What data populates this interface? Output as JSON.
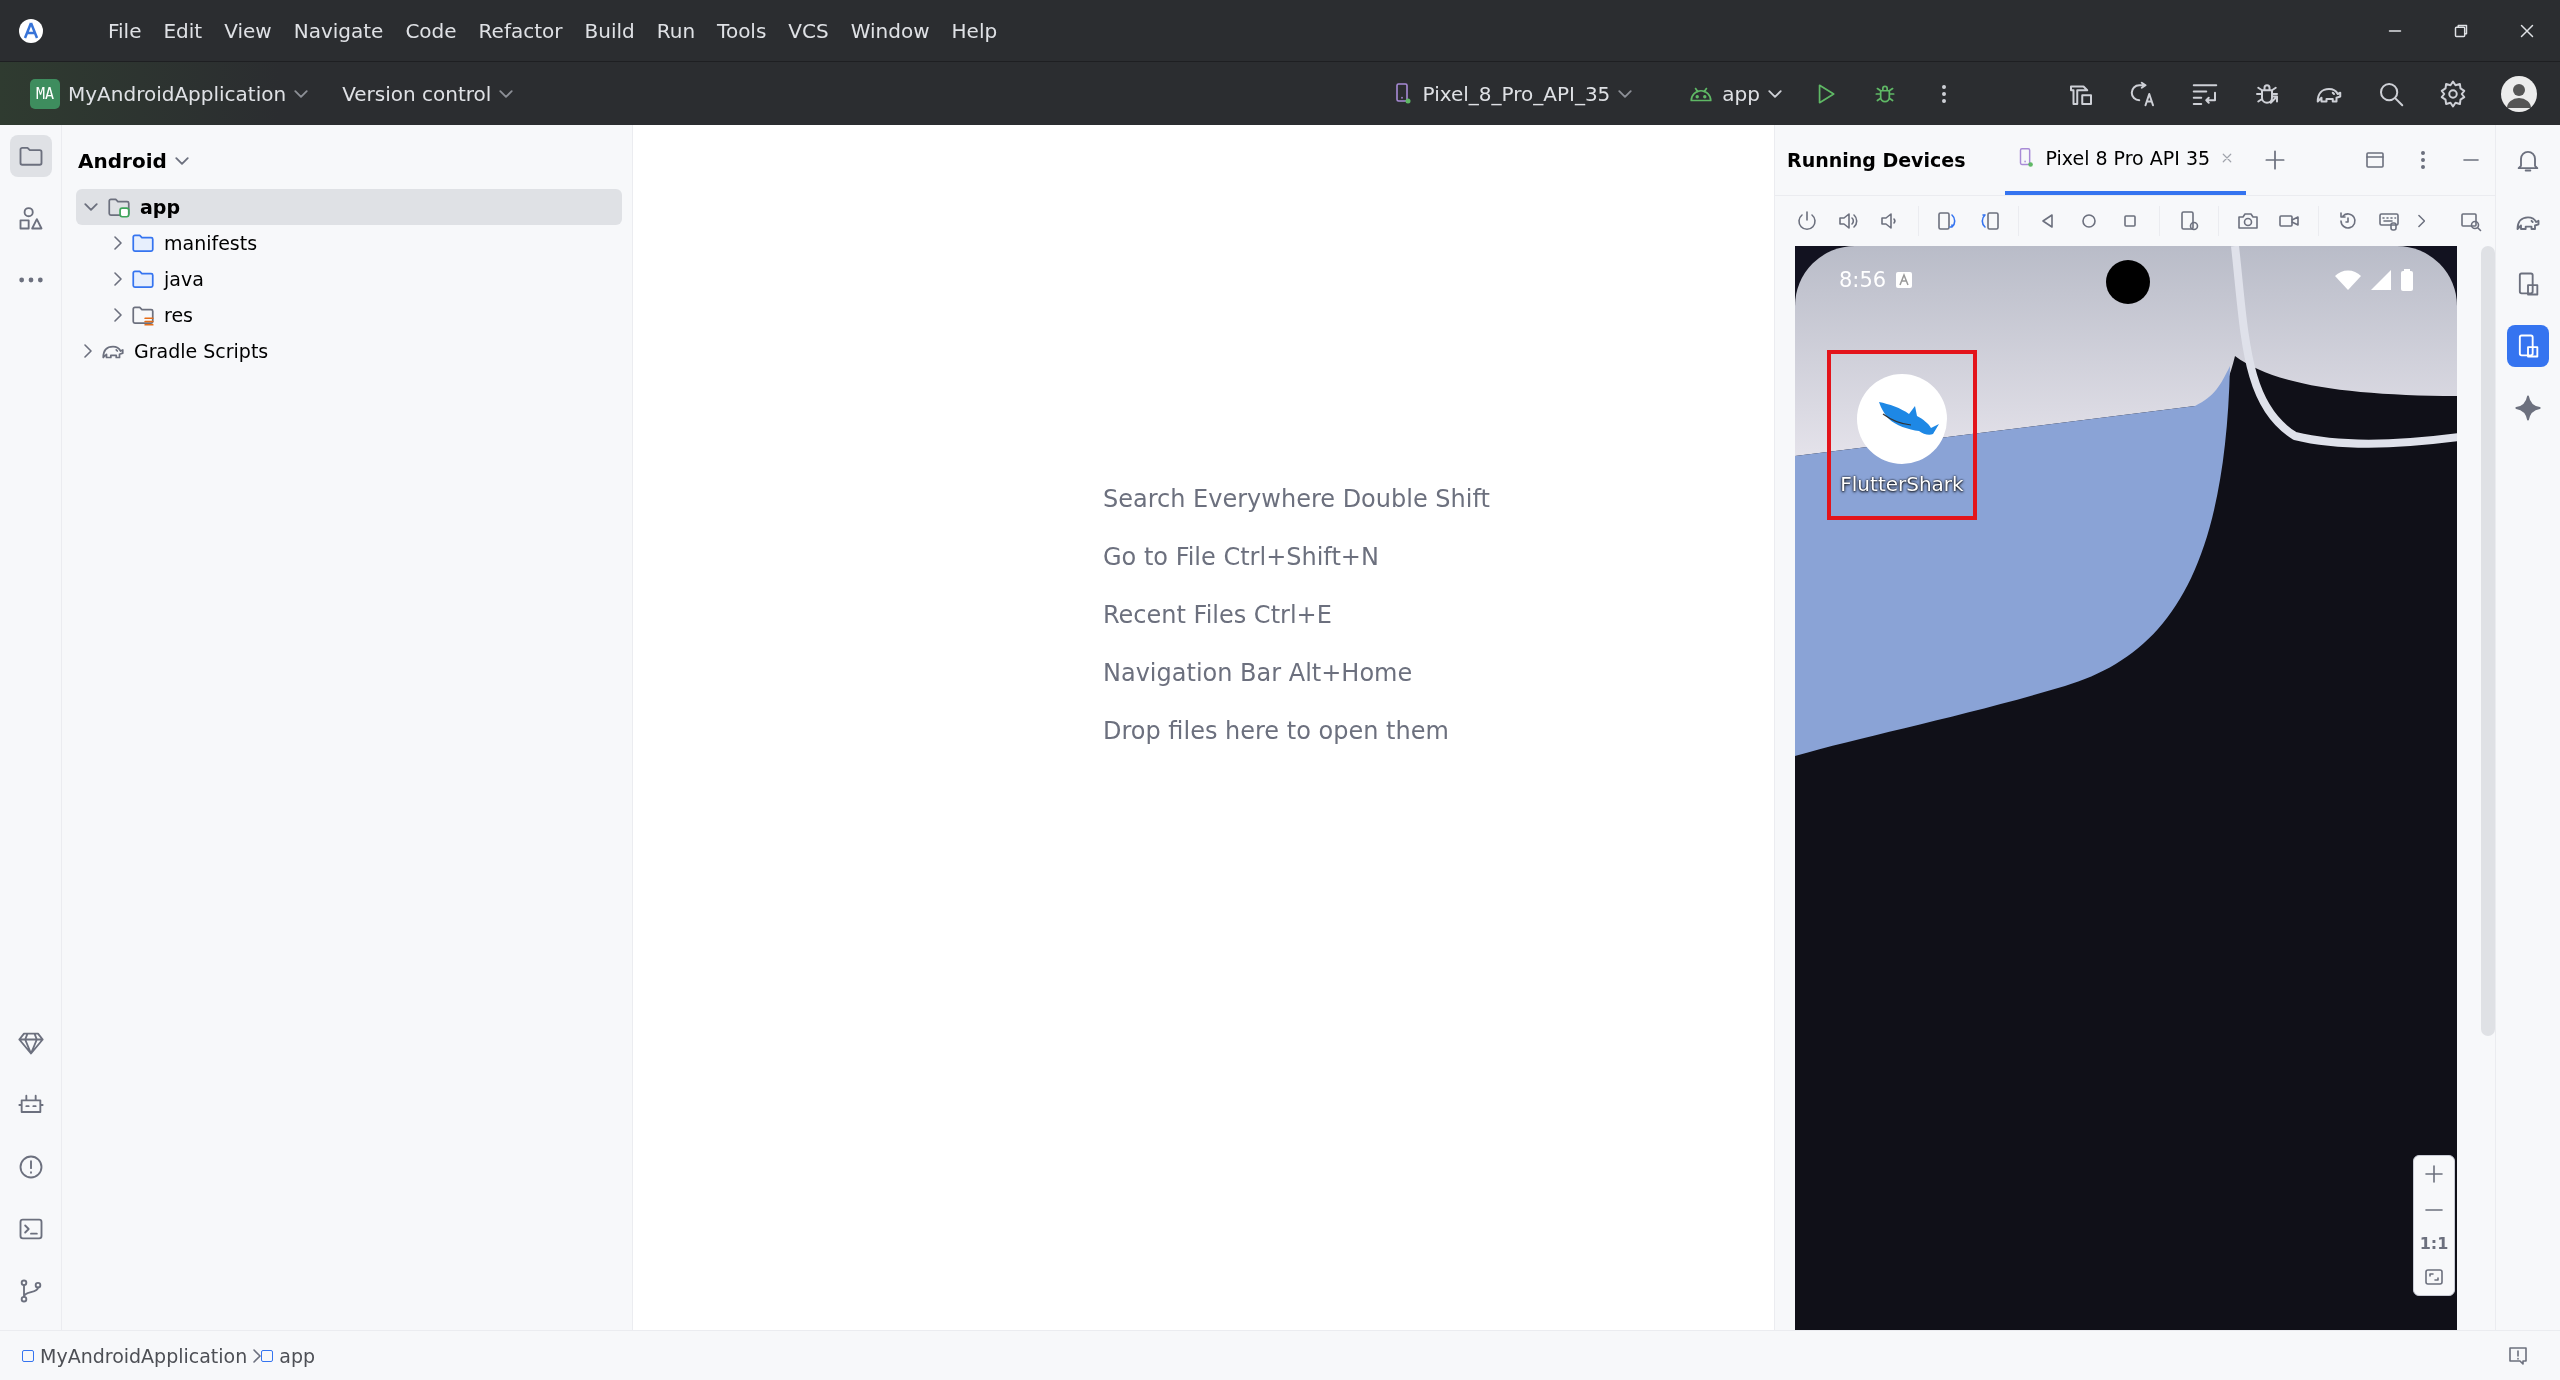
{
  "menu_bar": {
    "items": [
      "File",
      "Edit",
      "View",
      "Navigate",
      "Code",
      "Refactor",
      "Build",
      "Run",
      "Tools",
      "VCS",
      "Window",
      "Help"
    ]
  },
  "toolbar": {
    "project_badge": "MA",
    "project_name": "MyAndroidApplication",
    "version_control": "Version control",
    "device": "Pixel_8_Pro_API_35",
    "run_config": "app"
  },
  "left_strip": {
    "top": [
      {
        "selected": true
      },
      {
        "selected": false
      },
      {
        "selected": false
      }
    ],
    "bottom": [
      {
        "selected": false
      },
      {
        "selected": false
      },
      {
        "selected": false
      },
      {
        "selected": false
      },
      {
        "selected": false
      }
    ]
  },
  "project_panel": {
    "view": "Android",
    "tree": [
      {
        "label": "app",
        "kind": "module",
        "expanded": true,
        "selected": true,
        "children": [
          {
            "label": "manifests",
            "kind": "folder",
            "expanded": false,
            "selected": false
          },
          {
            "label": "java",
            "kind": "folder",
            "expanded": false,
            "selected": false
          },
          {
            "label": "res",
            "kind": "resources",
            "expanded": false,
            "selected": false
          }
        ]
      },
      {
        "label": "Gradle Scripts",
        "kind": "gradle",
        "expanded": false,
        "selected": false
      }
    ]
  },
  "editor": {
    "hints": [
      "Search Everywhere Double Shift",
      "Go to File Ctrl+Shift+N",
      "Recent Files Ctrl+E",
      "Navigation Bar Alt+Home",
      "Drop files here to open them"
    ]
  },
  "running_devices": {
    "title": "Running Devices",
    "tabs": [
      {
        "label": "Pixel 8 Pro API 35",
        "selected": true
      }
    ],
    "device_screen": {
      "time": "8:56",
      "apps": [
        {
          "label": "FlutterShark",
          "highlighted": true
        }
      ]
    },
    "zoom_controls": {
      "actual_size": "1:1"
    }
  },
  "right_strip": [
    {
      "selected": false
    },
    {
      "selected": false
    },
    {
      "selected": false
    },
    {
      "selected": true
    },
    {
      "selected": false
    }
  ],
  "breadcrumbs": [
    "MyAndroidApplication",
    "app"
  ]
}
